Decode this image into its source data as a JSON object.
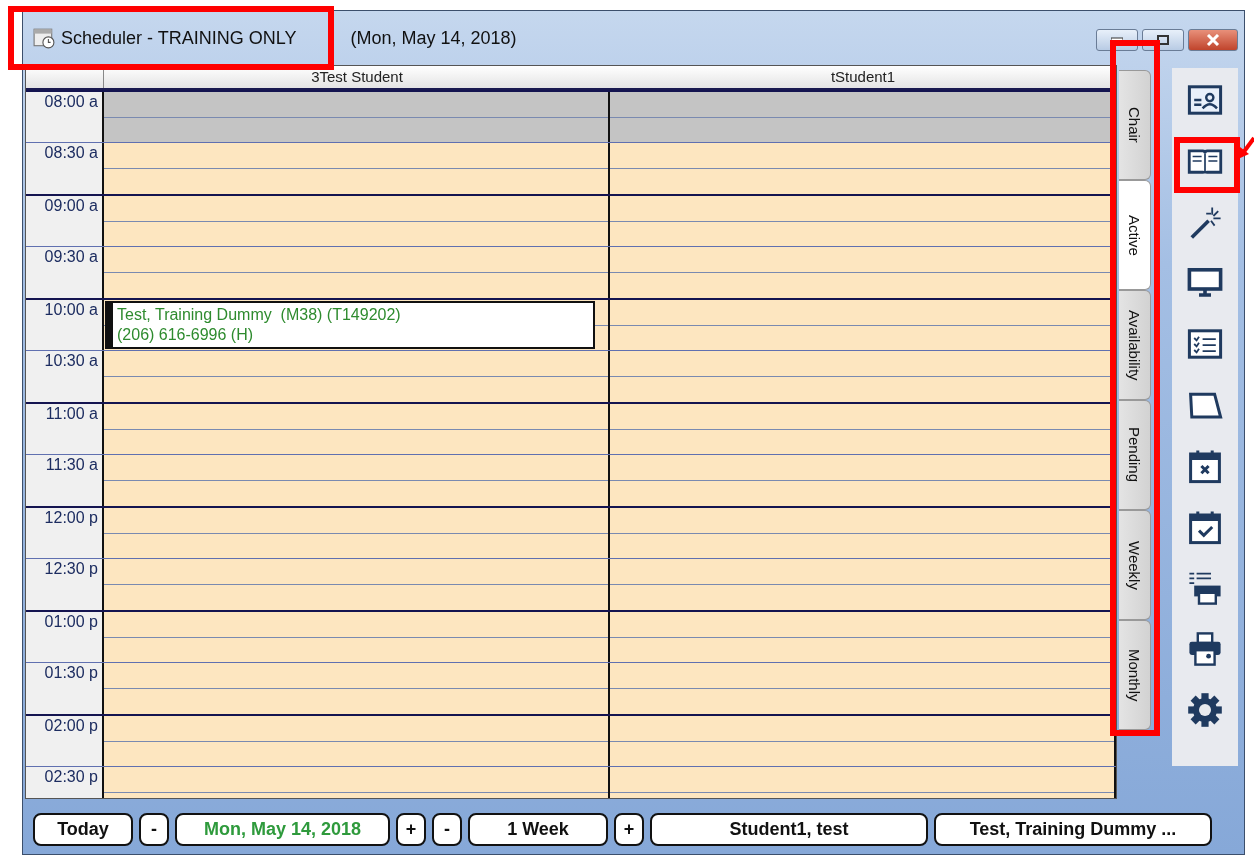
{
  "window": {
    "title": "Scheduler - TRAINING ONLY",
    "date": "(Mon, May 14, 2018)"
  },
  "columns": [
    {
      "name": "3Test Student"
    },
    {
      "name": "tStudent1"
    }
  ],
  "rows": [
    {
      "time": "08:00 a",
      "slots": [
        {
          "unavailable": true
        },
        {
          "unavailable": true
        }
      ]
    },
    {
      "time": "08:30 a",
      "slots": [
        {
          "unavailable": false
        },
        {
          "unavailable": false
        }
      ]
    },
    {
      "time": "09:00 a",
      "slots": [
        {
          "unavailable": false
        },
        {
          "unavailable": false
        }
      ]
    },
    {
      "time": "09:30 a",
      "slots": [
        {
          "unavailable": false
        },
        {
          "unavailable": false
        }
      ]
    },
    {
      "time": "10:00 a",
      "slots": [
        {
          "unavailable": false,
          "appointment": [
            "Test, Training Dummy  (M38) (T149202)",
            "(206) 616-6996 (H)"
          ]
        },
        {
          "unavailable": false
        }
      ]
    },
    {
      "time": "10:30 a",
      "slots": [
        {
          "unavailable": false
        },
        {
          "unavailable": false
        }
      ]
    },
    {
      "time": "11:00 a",
      "slots": [
        {
          "unavailable": false
        },
        {
          "unavailable": false
        }
      ]
    },
    {
      "time": "11:30 a",
      "slots": [
        {
          "unavailable": false
        },
        {
          "unavailable": false
        }
      ]
    },
    {
      "time": "12:00 p",
      "slots": [
        {
          "unavailable": false
        },
        {
          "unavailable": false
        }
      ]
    },
    {
      "time": "12:30 p",
      "slots": [
        {
          "unavailable": false
        },
        {
          "unavailable": false
        }
      ]
    },
    {
      "time": "01:00 p",
      "slots": [
        {
          "unavailable": false
        },
        {
          "unavailable": false
        }
      ]
    },
    {
      "time": "01:30 p",
      "slots": [
        {
          "unavailable": false
        },
        {
          "unavailable": false
        }
      ]
    },
    {
      "time": "02:00 p",
      "slots": [
        {
          "unavailable": false
        },
        {
          "unavailable": false
        }
      ]
    },
    {
      "time": "02:30 p",
      "slots": [
        {
          "unavailable": false
        },
        {
          "unavailable": false
        }
      ]
    }
  ],
  "tabs": [
    {
      "label": "Chair",
      "selected": false
    },
    {
      "label": "Active",
      "selected": true
    },
    {
      "label": "Availability",
      "selected": false
    },
    {
      "label": "Pending",
      "selected": false
    },
    {
      "label": "Weekly",
      "selected": false
    },
    {
      "label": "Monthly",
      "selected": false
    }
  ],
  "bottom_bar": [
    {
      "kind": "today",
      "label": "Today"
    },
    {
      "kind": "step",
      "label": "-"
    },
    {
      "kind": "date",
      "label": "Mon, May 14, 2018"
    },
    {
      "kind": "step",
      "label": "+"
    },
    {
      "kind": "step",
      "label": "-"
    },
    {
      "kind": "period",
      "label": "1 Week"
    },
    {
      "kind": "step",
      "label": "+"
    },
    {
      "kind": "person",
      "label": "Student1, test"
    },
    {
      "kind": "person",
      "label": "Test, Training Dummy ..."
    }
  ]
}
